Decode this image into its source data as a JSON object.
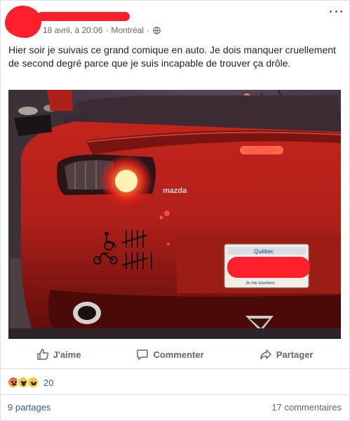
{
  "post": {
    "date": "18 avril, à 20:06",
    "separator": "·",
    "location": "Montréal",
    "privacy_icon": "globe-icon",
    "more_icon": "more-options-icon",
    "text": "Hier soir je suivais ce grand comique en auto. Je dois manquer cruellement de second degré parce que je suis incapable de trouver ça drôle."
  },
  "photo": {
    "car_badge": "mazda",
    "plate_region": "Québec",
    "plate_motto": "Je me souviens"
  },
  "actions": {
    "like": "J'aime",
    "comment": "Commenter",
    "share": "Partager"
  },
  "reactions": {
    "icons": [
      "angry-reaction-icon",
      "wow-reaction-icon",
      "sad-reaction-icon"
    ],
    "count": "20"
  },
  "footer": {
    "shares": "9 partages",
    "comments": "17 commentaires"
  },
  "colors": {
    "redaction": "#ff1f2d",
    "link": "#385898",
    "muted": "#606770"
  }
}
